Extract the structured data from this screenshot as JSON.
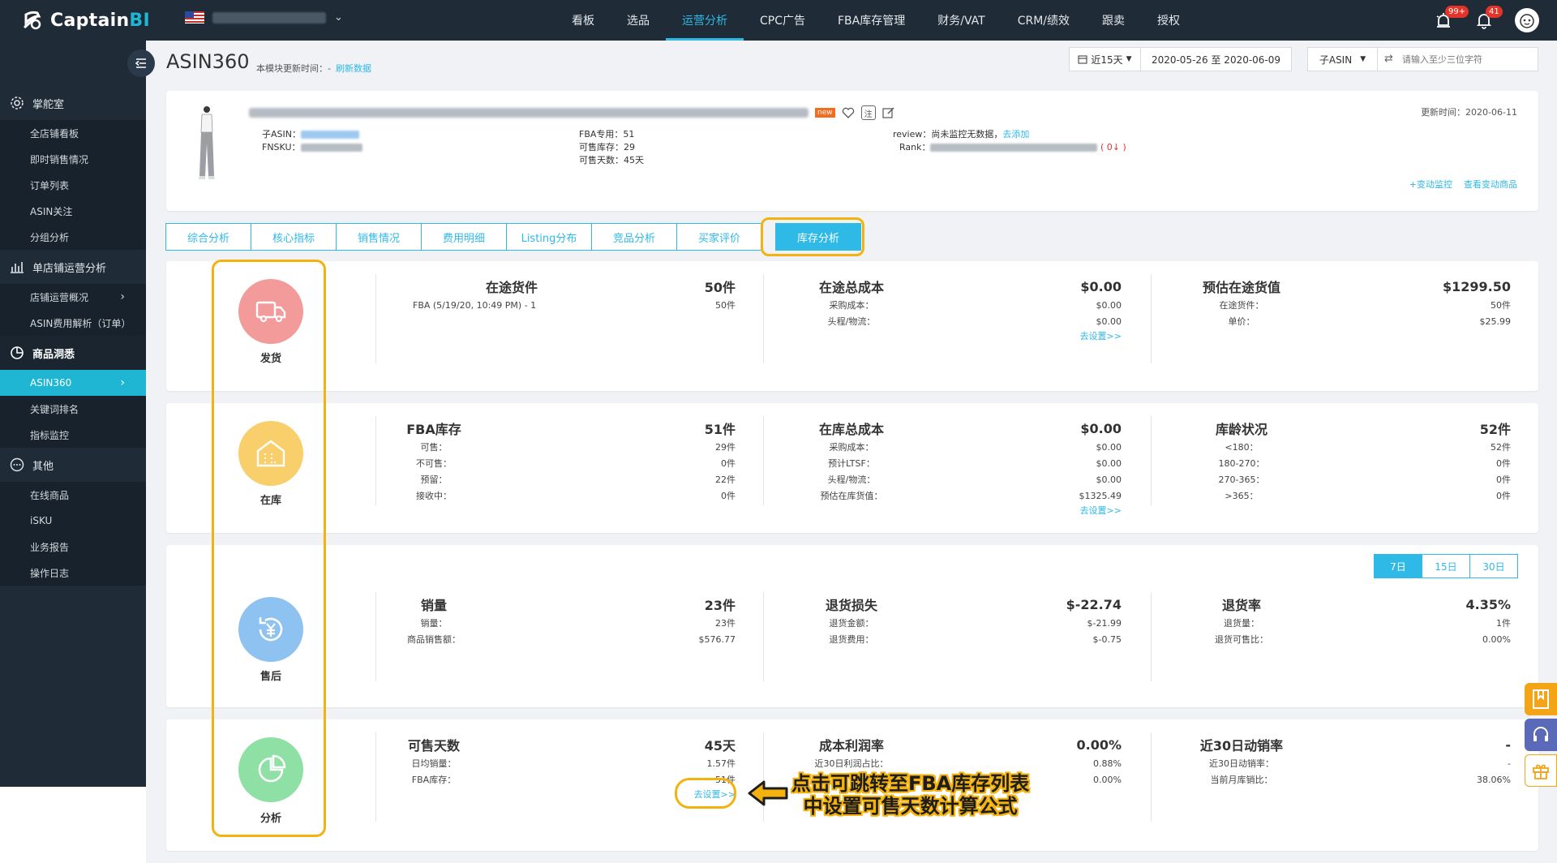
{
  "app": {
    "logo_text": "Captain",
    "logo_text_bi": "BI"
  },
  "header": {
    "nav": [
      "看板",
      "选品",
      "运营分析",
      "CPC广告",
      "FBA库存管理",
      "财务/VAT",
      "CRM/绩效",
      "跟卖",
      "授权"
    ],
    "active_nav_index": 2,
    "badges": {
      "alerts": "99+",
      "notifications": "41"
    }
  },
  "sidebar": {
    "groups": [
      {
        "label": "掌舵室",
        "icon": "gear-icon",
        "items": [
          "全店铺看板",
          "即时销售情况",
          "订单列表",
          "ASIN关注",
          "分组分析"
        ]
      },
      {
        "label": "单店铺运营分析",
        "icon": "bar-chart-icon",
        "items": [
          "店铺运营概况",
          "ASIN费用解析（订单）"
        ]
      },
      {
        "label": "商品洞悉",
        "icon": "pie-icon",
        "items": [
          "ASIN360",
          "关键词排名",
          "指标监控"
        ]
      },
      {
        "label": "其他",
        "icon": "more-icon",
        "items": [
          "在线商品",
          "iSKU",
          "业务报告",
          "操作日志"
        ]
      }
    ]
  },
  "page": {
    "title": "ASIN360",
    "update_note": "本模块更新时间：-",
    "refresh_label": "刷新数据",
    "date_range_btn": "近15天",
    "date_range": "2020-05-26 至 2020-06-09",
    "search_type": "子ASIN",
    "search_placeholder": "请输入至少三位字符"
  },
  "product": {
    "new_tag": "new",
    "note_icon_label": "注",
    "child_asin_label": "子ASIN：",
    "fnsku_label": "FNSKU：",
    "fba_only": "FBA专用：51",
    "sellable_stock": "可售库存：29",
    "sellable_days": "可售天数：45天",
    "review_label": "review：尚未监控无数据，",
    "review_link": "去添加",
    "rank_label": "Rank：",
    "rank_change": "( 0↓ )",
    "update_time": "更新时间：2020-06-11",
    "link_monitor": "+变动监控",
    "link_view_changes": "查看变动商品"
  },
  "tabs": [
    "综合分析",
    "核心指标",
    "销售情况",
    "费用明细",
    "Listing分布",
    "竞品分析",
    "买家评价",
    "库存分析"
  ],
  "active_tab_index": 7,
  "sections": {
    "ship": {
      "label": "发货",
      "c1": {
        "name": "在途货件",
        "value": "50件",
        "lines": [
          {
            "lbl": "FBA (5/19/20, 10:49 PM) - 1",
            "val": "50件"
          }
        ]
      },
      "c2": {
        "name": "在途总成本",
        "value": "$0.00",
        "lines": [
          {
            "lbl": "采购成本：",
            "val": "$0.00"
          },
          {
            "lbl": "头程/物流：",
            "val": "$0.00"
          }
        ],
        "go": "去设置>>"
      },
      "c3": {
        "name": "预估在途货值",
        "value": "$1299.50",
        "lines": [
          {
            "lbl": "在途货件：",
            "val": "50件"
          },
          {
            "lbl": "单价：",
            "val": "$25.99"
          }
        ]
      }
    },
    "stock": {
      "label": "在库",
      "c1": {
        "name": "FBA库存",
        "value": "51件",
        "lines": [
          {
            "lbl": "可售：",
            "val": "29件"
          },
          {
            "lbl": "不可售：",
            "val": "0件"
          },
          {
            "lbl": "预留：",
            "val": "22件"
          },
          {
            "lbl": "接收中：",
            "val": "0件"
          }
        ]
      },
      "c2": {
        "name": "在库总成本",
        "value": "$0.00",
        "lines": [
          {
            "lbl": "采购成本：",
            "val": "$0.00"
          },
          {
            "lbl": "预计LTSF：",
            "val": "$0.00"
          },
          {
            "lbl": "头程/物流：",
            "val": "$0.00"
          },
          {
            "lbl": "预估在库货值：",
            "val": "$1325.49"
          }
        ],
        "go": "去设置>>"
      },
      "c3": {
        "name": "库龄状况",
        "value": "52件",
        "lines": [
          {
            "lbl": "<180：",
            "val": "52件"
          },
          {
            "lbl": "180-270：",
            "val": "0件"
          },
          {
            "lbl": "270-365：",
            "val": "0件"
          },
          {
            "lbl": ">365：",
            "val": "0件"
          }
        ]
      }
    },
    "after": {
      "label": "售后",
      "periods": [
        "7日",
        "15日",
        "30日"
      ],
      "c1": {
        "name": "销量",
        "value": "23件",
        "lines": [
          {
            "lbl": "销量：",
            "val": "23件"
          },
          {
            "lbl": "商品销售额：",
            "val": "$576.77"
          }
        ]
      },
      "c2": {
        "name": "退货损失",
        "value": "$-22.74",
        "lines": [
          {
            "lbl": "退货金额：",
            "val": "$-21.99"
          },
          {
            "lbl": "退货费用：",
            "val": "$-0.75"
          }
        ]
      },
      "c3": {
        "name": "退货率",
        "value": "4.35%",
        "lines": [
          {
            "lbl": "退货量：",
            "val": "1件"
          },
          {
            "lbl": "退货可售比：",
            "val": "0.00%"
          }
        ]
      }
    },
    "analysis": {
      "label": "分析",
      "c1": {
        "name": "可售天数",
        "value": "45天",
        "lines": [
          {
            "lbl": "日均销量：",
            "val": "1.57件"
          },
          {
            "lbl": "FBA库存：",
            "val": "51件"
          }
        ],
        "go": "去设置>>"
      },
      "c2": {
        "name": "成本利润率",
        "value": "0.00%",
        "lines": [
          {
            "lbl": "近30日利润占比：",
            "val": "0.88%"
          },
          {
            "lbl": "",
            "val": "0.00%"
          }
        ]
      },
      "c3": {
        "name": "近30日动销率",
        "value": "-",
        "lines": [
          {
            "lbl": "近30日动销率：",
            "val": "-"
          },
          {
            "lbl": "当前月库销比：",
            "val": "38.06%"
          }
        ]
      }
    }
  },
  "annotation": {
    "line1": "点击可跳转至FBA库存列表",
    "line2": "中设置可售天数计算公式"
  },
  "colors": {
    "accent": "#2fb9e6",
    "highlight": "#f3b20e",
    "sidebar_bg": "#1f2b37",
    "ship": "#f39a9a",
    "stock": "#f9cf6b",
    "after": "#8ec2f0",
    "analysis": "#8ee0a4"
  }
}
